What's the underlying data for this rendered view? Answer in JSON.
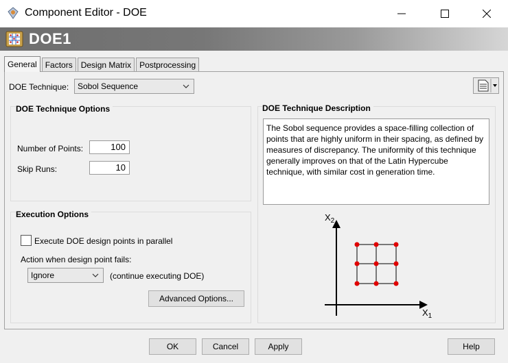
{
  "window": {
    "title": "Component Editor - DOE",
    "controls": [
      "minimize",
      "maximize",
      "close"
    ]
  },
  "header": {
    "title": "DOE1"
  },
  "tabs": [
    {
      "label": "General",
      "active": true
    },
    {
      "label": "Factors",
      "active": false
    },
    {
      "label": "Design Matrix",
      "active": false
    },
    {
      "label": "Postprocessing",
      "active": false
    }
  ],
  "general": {
    "technique_label": "DOE Technique:",
    "technique_value": "Sobol Sequence",
    "technique_options": {
      "title": "DOE Technique Options",
      "num_points_label": "Number of Points:",
      "num_points_value": "100",
      "skip_runs_label": "Skip Runs:",
      "skip_runs_value": "10"
    },
    "execution_options": {
      "title": "Execution Options",
      "parallel_label": "Execute DOE design points in parallel",
      "parallel_checked": false,
      "action_label": "Action when design point fails:",
      "action_value": "Ignore",
      "action_note": "(continue executing DOE)",
      "advanced_button": "Advanced Options..."
    },
    "description": {
      "title": "DOE Technique Description",
      "text": "The Sobol sequence provides a space-filling collection of points that are highly uniform in their spacing, as defined by measures of discrepancy. The uniformity of this technique generally improves on that of the Latin Hypercube technique, with similar cost in generation time."
    },
    "diagram": {
      "y_axis_label": "X",
      "y_axis_sub": "2",
      "x_axis_label": "X",
      "x_axis_sub": "1",
      "point_color": "#e00000"
    }
  },
  "footer": {
    "ok": "OK",
    "cancel": "Cancel",
    "apply": "Apply",
    "help": "Help"
  }
}
